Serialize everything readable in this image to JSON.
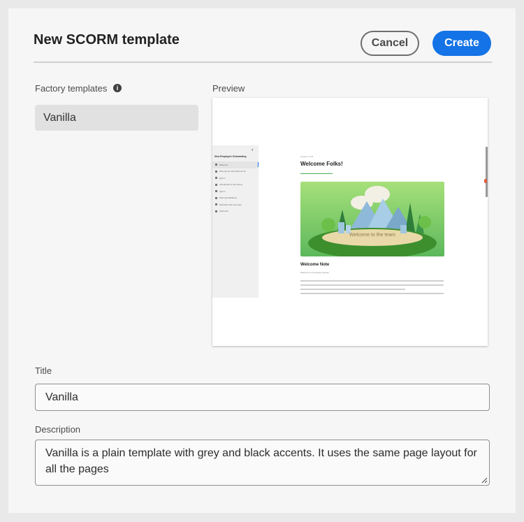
{
  "dialog": {
    "title": "New SCORM template",
    "cancel_label": "Cancel",
    "create_label": "Create"
  },
  "factory": {
    "label": "Factory templates",
    "info_icon": "info-icon",
    "selected": "Vanilla"
  },
  "preview": {
    "label": "Preview",
    "course_title": "New Employee Onboarding",
    "nav_items": [
      "Welcome",
      "Who we are and what we do",
      "Quiz 1",
      "Introduction to the teams",
      "Quiz 2",
      "Role specifications",
      "Schedule and next step",
      "Final quiz"
    ],
    "lesson_label": "Lesson 1 of 8",
    "heading": "Welcome Folks!",
    "hero_caption": "Welcome to the team",
    "section_heading": "Welcome Note",
    "section_intro": "Welcome to [Company Name]!",
    "accent_color": "#4caf50"
  },
  "form": {
    "title_label": "Title",
    "title_value": "Vanilla",
    "description_label": "Description",
    "description_value": "Vanilla is a plain template with grey and black accents. It uses the same page layout for all the pages"
  },
  "colors": {
    "primary": "#1473e6",
    "background": "#f6f6f6"
  }
}
